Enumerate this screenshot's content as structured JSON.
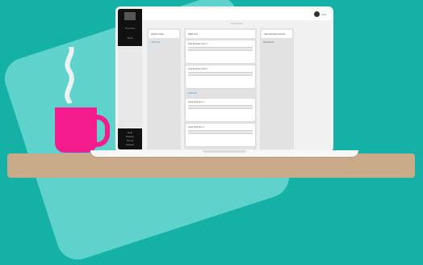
{
  "scene": {
    "colors": {
      "background": "#15b1a6",
      "blob": "#5ed2cb",
      "cup": "#f41b8e",
      "shelf": "#c9ab8a"
    }
  },
  "app": {
    "topbar": {
      "center_text": "Add columns",
      "user_label": "Lind"
    },
    "sidebar": {
      "items": [
        "Overview",
        "Tasks"
      ],
      "footer": [
        "Help",
        "Privacy",
        "Terms",
        "Contact"
      ]
    },
    "columns": [
      {
        "title": "Quick notes",
        "cards": [
          "+ Add note"
        ]
      },
      {
        "title": "Task List",
        "cards": [
          "Task Example Card 1",
          "Task Example Card 2",
          "Great Task Item 3",
          "Great Task Item 4"
        ],
        "add_label": "+ Add card"
      },
      {
        "title": "Internal Documents",
        "cards": [
          "Document 1"
        ]
      }
    ]
  }
}
